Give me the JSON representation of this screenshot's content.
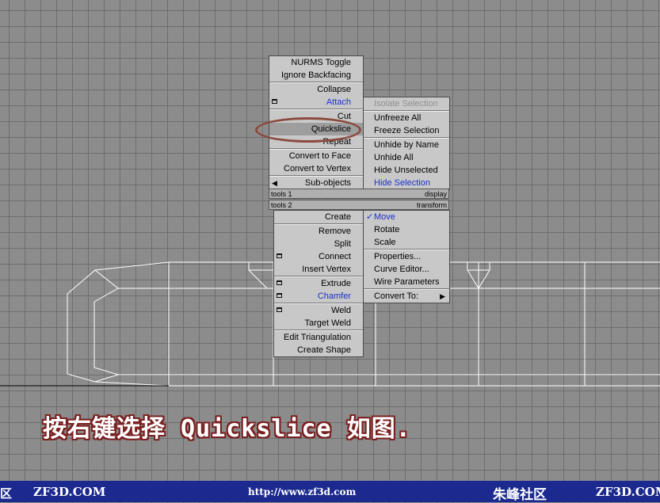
{
  "menu_left_top": [
    {
      "label": "NURMS Toggle"
    },
    {
      "label": "Ignore Backfacing"
    },
    {
      "sep": true
    },
    {
      "label": "Collapse"
    },
    {
      "label": "Attach",
      "blue": true,
      "box": true
    },
    {
      "sep": true
    },
    {
      "label": "Cut"
    },
    {
      "label": "Quickslice",
      "hl": true
    },
    {
      "label": "Repeat"
    },
    {
      "sep": true
    },
    {
      "label": "Convert to Face"
    },
    {
      "label": "Convert to Vertex"
    },
    {
      "sep": true
    },
    {
      "label": "Sub-objects",
      "arrow_left": true
    }
  ],
  "menu_right_top": [
    {
      "label": "Isolate Selection",
      "disabled": true
    },
    {
      "sep": true
    },
    {
      "label": "Unfreeze All"
    },
    {
      "label": "Freeze Selection"
    },
    {
      "sep": true
    },
    {
      "label": "Unhide by Name"
    },
    {
      "label": "Unhide All"
    },
    {
      "label": "Hide Unselected"
    },
    {
      "label": "Hide Selection",
      "blue": true
    }
  ],
  "titles": {
    "tools1": "tools 1",
    "display": "display",
    "tools2": "tools 2",
    "transform": "transform"
  },
  "menu_left_bottom": [
    {
      "label": "Create"
    },
    {
      "sep": true
    },
    {
      "label": "Remove"
    },
    {
      "label": "Split"
    },
    {
      "label": "Connect",
      "box": true
    },
    {
      "label": "Insert Vertex"
    },
    {
      "sep": true
    },
    {
      "label": "Extrude",
      "box": true
    },
    {
      "label": "Chamfer",
      "blue": true,
      "box": true
    },
    {
      "sep": true
    },
    {
      "label": "Weld",
      "box": true
    },
    {
      "label": "Target Weld"
    },
    {
      "sep": true
    },
    {
      "label": "Edit Triangulation"
    },
    {
      "label": "Create Shape"
    }
  ],
  "menu_right_bottom": [
    {
      "label": "Move",
      "blue": true,
      "check": true
    },
    {
      "label": "Rotate"
    },
    {
      "label": "Scale"
    },
    {
      "sep": true
    },
    {
      "label": "Properties..."
    },
    {
      "label": "Curve Editor..."
    },
    {
      "label": "Wire Parameters"
    },
    {
      "sep": true
    },
    {
      "label": "Convert To:",
      "arrow_right": true
    }
  ],
  "caption": "按右键选择 Quickslice 如图.",
  "footer": {
    "left_char": "区",
    "left_site": "ZF3D.COM",
    "url": "http://www.zf3d.com",
    "brand": "朱峰社区",
    "right_site": "ZF3D.COM"
  }
}
